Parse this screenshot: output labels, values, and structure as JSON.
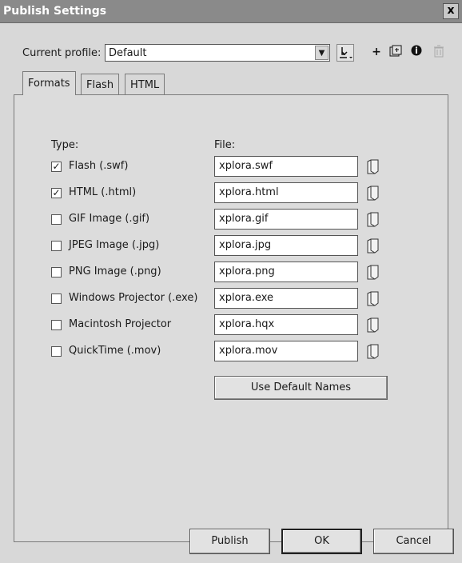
{
  "window": {
    "title": "Publish Settings",
    "close_label": "x"
  },
  "profile": {
    "label": "Current profile:",
    "value": "Default"
  },
  "toolbar": {
    "icons": [
      "import-export-icon",
      "add-profile-icon",
      "duplicate-profile-icon",
      "profile-info-icon",
      "delete-profile-icon"
    ]
  },
  "tabs": [
    {
      "label": "Formats",
      "active": true
    },
    {
      "label": "Flash",
      "active": false
    },
    {
      "label": "HTML",
      "active": false
    }
  ],
  "formats": {
    "type_header": "Type:",
    "file_header": "File:",
    "rows": [
      {
        "label": "Flash  (.swf)",
        "checked": true,
        "file": "xplora.swf"
      },
      {
        "label": "HTML (.html)",
        "checked": true,
        "file": "xplora.html"
      },
      {
        "label": "GIF Image (.gif)",
        "checked": false,
        "file": "xplora.gif"
      },
      {
        "label": "JPEG Image (.jpg)",
        "checked": false,
        "file": "xplora.jpg"
      },
      {
        "label": "PNG Image (.png)",
        "checked": false,
        "file": "xplora.png"
      },
      {
        "label": "Windows Projector (.exe)",
        "checked": false,
        "file": "xplora.exe"
      },
      {
        "label": "Macintosh Projector",
        "checked": false,
        "file": "xplora.hqx"
      },
      {
        "label": "QuickTime (.mov)",
        "checked": false,
        "file": "xplora.mov"
      }
    ],
    "default_names_label": "Use Default Names"
  },
  "buttons": {
    "publish": "Publish",
    "ok": "OK",
    "cancel": "Cancel"
  }
}
